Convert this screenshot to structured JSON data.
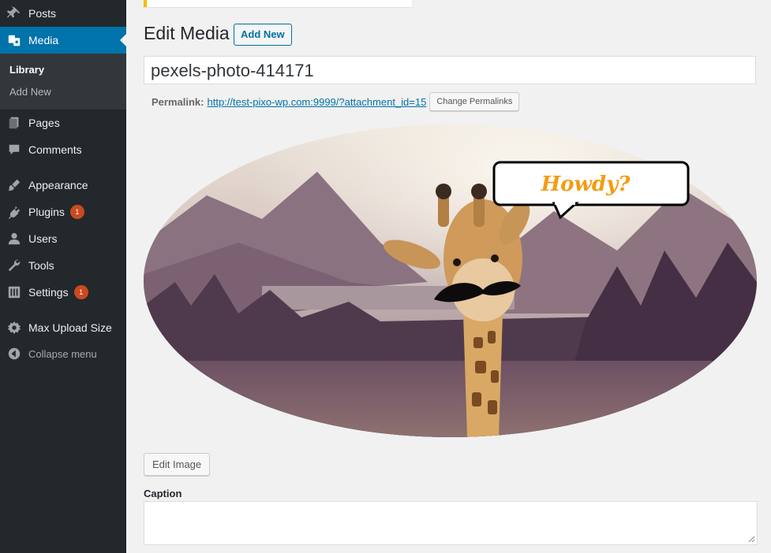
{
  "sidebar": {
    "items": [
      {
        "label": "Posts",
        "icon": "pin-icon"
      },
      {
        "label": "Media",
        "icon": "media-icon"
      },
      {
        "label": "Pages",
        "icon": "pages-icon"
      },
      {
        "label": "Comments",
        "icon": "comment-icon"
      },
      {
        "label": "Appearance",
        "icon": "brush-icon"
      },
      {
        "label": "Plugins",
        "icon": "plugin-icon",
        "badge": "1"
      },
      {
        "label": "Users",
        "icon": "user-icon"
      },
      {
        "label": "Tools",
        "icon": "wrench-icon"
      },
      {
        "label": "Settings",
        "icon": "settings-icon",
        "badge": "1"
      },
      {
        "label": "Max Upload Size",
        "icon": "gear-icon"
      }
    ],
    "submenu": [
      {
        "label": "Library"
      },
      {
        "label": "Add New"
      }
    ],
    "collapse_label": "Collapse menu"
  },
  "main": {
    "title": "Edit Media",
    "add_new_label": "Add New",
    "title_value": "pexels-photo-414171",
    "permalink_label": "Permalink:",
    "permalink_url": "http://test-pixo-wp.com:9999/?attachment_id=15",
    "change_permalinks_label": "Change Permalinks",
    "speech_bubble_text": "Howdy?",
    "edit_image_label": "Edit Image",
    "caption_label": "Caption",
    "caption_value": ""
  },
  "colors": {
    "sidebar_bg": "#23282d",
    "active": "#0073aa",
    "badge": "#ca4a1f",
    "notice": "#ffb900",
    "bubble_text": "#f39c12"
  }
}
